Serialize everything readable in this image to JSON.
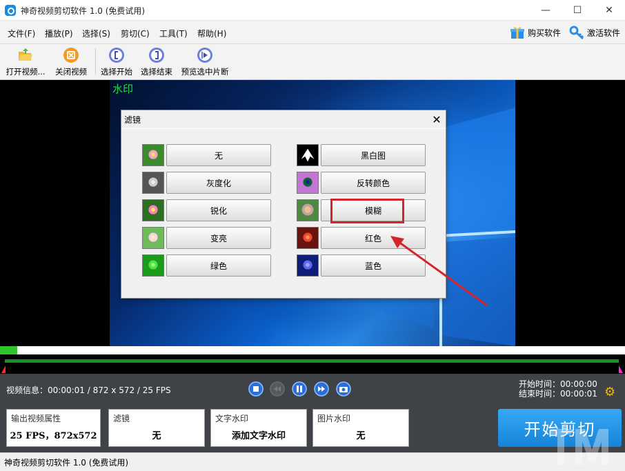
{
  "window": {
    "title": "神奇视频剪切软件 1.0 (免费试用)",
    "minimize_glyph": "—",
    "maximize_glyph": "☐",
    "close_glyph": "✕"
  },
  "menu": {
    "items": [
      "文件(F)",
      "播放(P)",
      "选择(S)",
      "剪切(C)",
      "工具(T)",
      "帮助(H)"
    ],
    "buy_label": "购买软件",
    "activate_label": "激活软件"
  },
  "toolbar": {
    "open_label": "打开视频...",
    "close_label": "关闭视频",
    "select_start_label": "选择开始",
    "select_end_label": "选择结束",
    "preview_label": "预览选中片断"
  },
  "video": {
    "watermark_text": "水印"
  },
  "dialog": {
    "title": "滤镜",
    "close_glyph": "✕",
    "filters_left": [
      "无",
      "灰度化",
      "锐化",
      "变亮",
      "绿色"
    ],
    "filters_right": [
      "黑白图",
      "反转颜色",
      "模糊",
      "红色",
      "蓝色"
    ],
    "highlighted": "模糊"
  },
  "timeline": {
    "progress_fraction": 0.028
  },
  "controls": {
    "video_info": "视频信息：00:00:01 / 872 x 572 / 25 FPS",
    "start_time_label": "开始时间：",
    "start_time": "00:00:00",
    "end_time_label": "结束时间：",
    "end_time": "00:00:01"
  },
  "cards": {
    "output": {
      "title": "输出视频属性",
      "value": "25 FPS，872x572"
    },
    "filter": {
      "title": "滤镜",
      "value": "无"
    },
    "text_watermark": {
      "title": "文字水印",
      "value": "添加文字水印"
    },
    "image_watermark": {
      "title": "图片水印",
      "value": "无"
    }
  },
  "start_button_label": "开始剪切",
  "status": {
    "text": "神奇视频剪切软件 1.0 (免费试用)"
  },
  "colors": {
    "accent_blue": "#1683d8",
    "highlight_red": "#d5252b",
    "panel_dark": "#3f4246",
    "watermark_green": "#19e04a"
  }
}
